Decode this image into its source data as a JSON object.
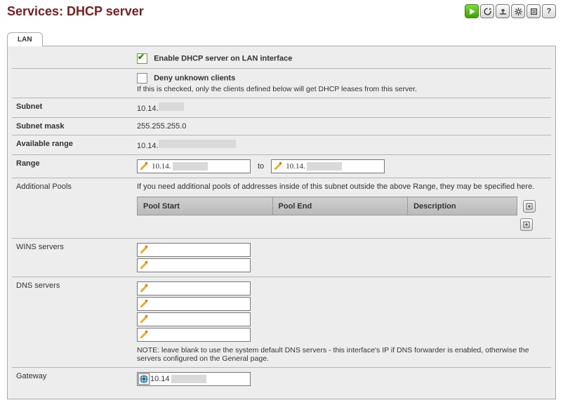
{
  "title": "Services: DHCP server",
  "icons": {
    "play": "start-service",
    "reload": "reload-service",
    "upload": "upload-config",
    "settings": "service-settings",
    "log": "show-log",
    "help": "help"
  },
  "tab": {
    "lan": "LAN"
  },
  "enable": {
    "label": "Enable DHCP server on LAN interface",
    "checked": true
  },
  "deny": {
    "label": "Deny unknown clients",
    "help": "If this is checked, only the clients defined below will get DHCP leases from this server.",
    "checked": false
  },
  "rows": {
    "subnet_label": "Subnet",
    "subnet_value": "10.14.",
    "mask_label": "Subnet mask",
    "mask_value": "255.255.255.0",
    "avail_label": "Available range",
    "avail_value": "10.14.",
    "range_label": "Range",
    "range_from": "10.14.",
    "range_to_sep": "to",
    "range_to": "10.14.",
    "pools_label": "Additional Pools",
    "pools_help": "If you need additional pools of addresses inside of this subnet outside the above Range, they may be specified here.",
    "pool_cols": {
      "start": "Pool Start",
      "end": "Pool End",
      "desc": "Description"
    },
    "wins_label": "WINS servers",
    "dns_label": "DNS servers",
    "dns_note": "NOTE: leave blank to use the system default DNS servers - this interface's IP if DNS forwarder is enabled, otherwise the servers configured on the General page.",
    "gateway_label": "Gateway",
    "gateway_value": "10.14"
  }
}
